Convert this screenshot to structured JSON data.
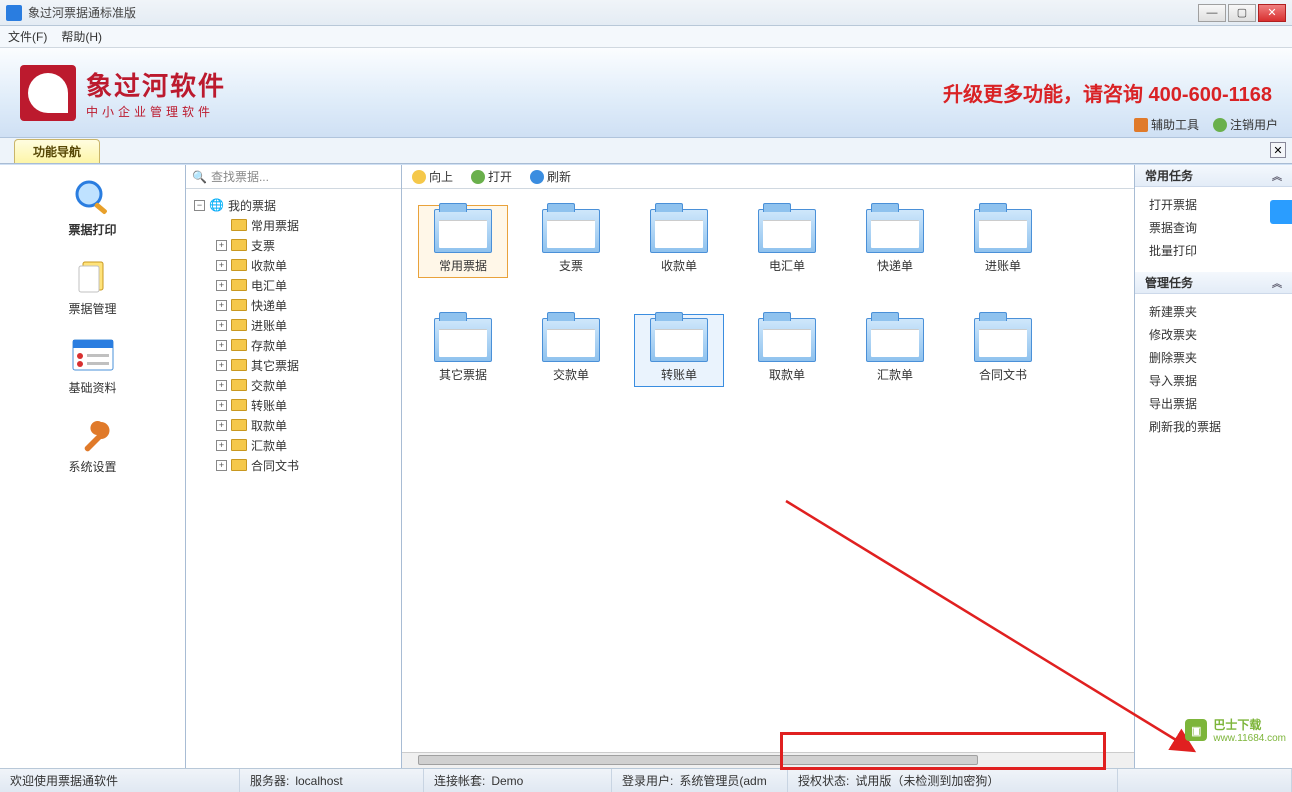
{
  "window": {
    "title": "象过河票据通标准版"
  },
  "menu": {
    "file": "文件(F)",
    "help": "帮助(H)"
  },
  "brand": {
    "name": "象过河软件",
    "subtitle": "中小企业管理软件",
    "promo": "升级更多功能，请咨询 400-600-1168"
  },
  "brand_tools": {
    "assist": "辅助工具",
    "logout": "注销用户"
  },
  "nav_tab": "功能导航",
  "left_nav": [
    {
      "label": "票据打印"
    },
    {
      "label": "票据管理"
    },
    {
      "label": "基础资料"
    },
    {
      "label": "系统设置"
    }
  ],
  "search_placeholder": "查找票据...",
  "tree_root": "我的票据",
  "tree_children": [
    "常用票据",
    "支票",
    "收款单",
    "电汇单",
    "快递单",
    "进账单",
    "存款单",
    "其它票据",
    "交款单",
    "转账单",
    "取款单",
    "汇款单",
    "合同文书"
  ],
  "toolbar": {
    "up": "向上",
    "open": "打开",
    "refresh": "刷新"
  },
  "folders_row1": [
    "常用票据",
    "支票",
    "收款单",
    "电汇单",
    "快递单",
    "进账单"
  ],
  "folders_row2": [
    "其它票据",
    "交款单",
    "转账单",
    "取款单",
    "汇款单",
    "合同文书"
  ],
  "right_panel": {
    "common_header": "常用任务",
    "common_items": [
      "打开票据",
      "票据查询",
      "批量打印"
    ],
    "manage_header": "管理任务",
    "manage_items": [
      "新建票夹",
      "修改票夹",
      "删除票夹",
      "导入票据",
      "导出票据",
      "刷新我的票据"
    ]
  },
  "status": {
    "welcome": "欢迎使用票据通软件",
    "server_label": "服务器:",
    "server_value": "localhost",
    "account_label": "连接帐套:",
    "account_value": "Demo",
    "user_label": "登录用户:",
    "user_value": "系统管理员(adm",
    "license_label": "授权状态:",
    "license_value": "试用版（未检测到加密狗）"
  },
  "watermark": {
    "text": "巴士下载",
    "url": "www.11684.com"
  }
}
